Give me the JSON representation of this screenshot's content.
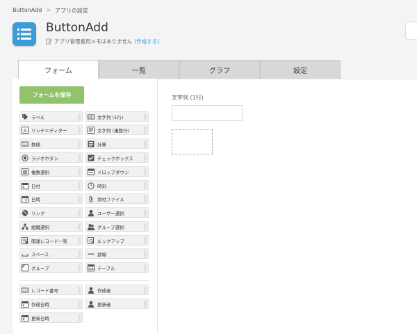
{
  "breadcrumb": {
    "root": "ButtonAdd",
    "separator": ">",
    "current": "アプリの設定"
  },
  "app": {
    "title": "ButtonAdd",
    "memo_text": "アプリ管理者用メモはありません",
    "memo_link": "(作成する)",
    "icon": "list-icon",
    "icon_color": "#3d9bd6"
  },
  "tabs": [
    {
      "label": "フォーム",
      "active": true
    },
    {
      "label": "一覧",
      "active": false
    },
    {
      "label": "グラフ",
      "active": false
    },
    {
      "label": "設定",
      "active": false
    }
  ],
  "save_button": {
    "label": "フォームを保存",
    "color": "#91c36c"
  },
  "fields_left": [
    {
      "label": "ラベル",
      "icon": "tag-icon"
    },
    {
      "label": "リッチエディター",
      "icon": "rich-text-icon"
    },
    {
      "label": "数値",
      "icon": "number-icon"
    },
    {
      "label": "ラジオボタン",
      "icon": "radio-icon"
    },
    {
      "label": "複数選択",
      "icon": "multi-select-icon"
    },
    {
      "label": "日付",
      "icon": "calendar-icon"
    },
    {
      "label": "日時",
      "icon": "datetime-icon"
    },
    {
      "label": "リンク",
      "icon": "globe-icon"
    },
    {
      "label": "組織選択",
      "icon": "org-icon"
    },
    {
      "label": "関連レコード一覧",
      "icon": "related-records-icon"
    },
    {
      "label": "スペース",
      "icon": "space-icon"
    },
    {
      "label": "グループ",
      "icon": "group-icon"
    }
  ],
  "fields_right": [
    {
      "label": "文字列 (1行)",
      "icon": "single-line-text-icon"
    },
    {
      "label": "文字列 (複数行)",
      "icon": "multi-line-text-icon"
    },
    {
      "label": "計算",
      "icon": "calculator-icon"
    },
    {
      "label": "チェックボックス",
      "icon": "checkbox-icon"
    },
    {
      "label": "ドロップダウン",
      "icon": "dropdown-icon"
    },
    {
      "label": "時刻",
      "icon": "clock-icon"
    },
    {
      "label": "添付ファイル",
      "icon": "paperclip-icon"
    },
    {
      "label": "ユーザー選択",
      "icon": "user-icon"
    },
    {
      "label": "グループ選択",
      "icon": "users-icon"
    },
    {
      "label": "ルックアップ",
      "icon": "lookup-icon"
    },
    {
      "label": "罫線",
      "icon": "line-icon"
    },
    {
      "label": "テーブル",
      "icon": "table-icon"
    }
  ],
  "system_left": [
    {
      "label": "レコード番号",
      "icon": "record-number-icon"
    },
    {
      "label": "作成日時",
      "icon": "calendar-icon"
    },
    {
      "label": "更新日時",
      "icon": "calendar-icon"
    }
  ],
  "system_right": [
    {
      "label": "作成者",
      "icon": "user-icon"
    },
    {
      "label": "更新者",
      "icon": "user-icon"
    }
  ],
  "canvas": {
    "field_label": "文字列 (1行)"
  }
}
